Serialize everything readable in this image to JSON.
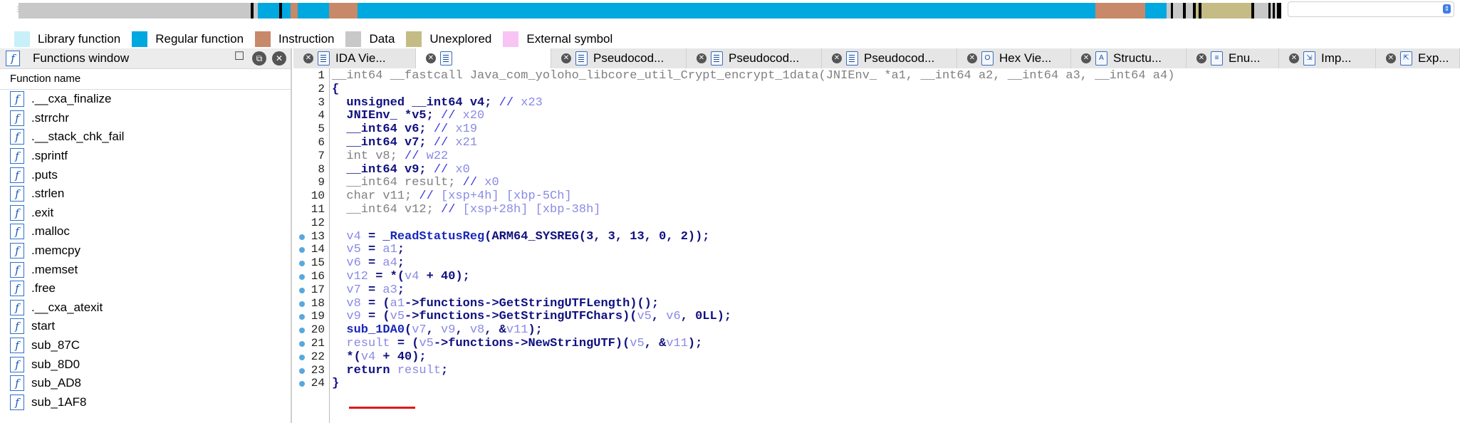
{
  "legend": [
    {
      "label": "Library function",
      "color": "#c8f0f8"
    },
    {
      "label": "Regular function",
      "color": "#00a8e0"
    },
    {
      "label": "Instruction",
      "color": "#c8886a"
    },
    {
      "label": "Data",
      "color": "#c8c8c8"
    },
    {
      "label": "Unexplored",
      "color": "#c4bc84"
    },
    {
      "label": "External symbol",
      "color": "#f8c4f4"
    }
  ],
  "functions_window": {
    "title": "Functions window",
    "column_header": "Function name",
    "items": [
      ".__cxa_finalize",
      ".strrchr",
      ".__stack_chk_fail",
      ".sprintf",
      ".puts",
      ".strlen",
      ".exit",
      ".malloc",
      ".memcpy",
      ".memset",
      ".free",
      ".__cxa_atexit",
      "start",
      "sub_87C",
      "sub_8D0",
      "sub_AD8",
      "sub_1AF8"
    ]
  },
  "tabs": [
    {
      "label": "IDA Vie...",
      "icon": "ida-view-icon"
    },
    {
      "label": "",
      "icon": "pseudocode-icon",
      "active": true
    },
    {
      "label": "Pseudocod...",
      "icon": "pseudocode-icon"
    },
    {
      "label": "Pseudocod...",
      "icon": "pseudocode-icon"
    },
    {
      "label": "Pseudocod...",
      "icon": "pseudocode-icon"
    },
    {
      "label": "Hex Vie...",
      "icon": "hex-view-icon"
    },
    {
      "label": "Structu...",
      "icon": "structures-icon"
    },
    {
      "label": "Enu...",
      "icon": "enums-icon"
    },
    {
      "label": "Imp...",
      "icon": "imports-icon"
    },
    {
      "label": "Exp...",
      "icon": "exports-icon"
    }
  ],
  "code": {
    "lines": [
      {
        "n": "1",
        "bp": false,
        "parts": [
          [
            "gray",
            "__int64 __fastcall Java_com_yoloho_libcore_util_Crypt_encrypt_1data(JNIEnv_ *a1, __int64 a2, __int64 a3, __int64 a4)"
          ]
        ]
      },
      {
        "n": "2",
        "bp": false,
        "parts": [
          [
            "navy",
            "{"
          ]
        ]
      },
      {
        "n": "3",
        "bp": false,
        "parts": [
          [
            "navy",
            "  unsigned __int64 v4; "
          ],
          [
            "cmt",
            "// "
          ],
          [
            "lb",
            "x23"
          ]
        ]
      },
      {
        "n": "4",
        "bp": false,
        "parts": [
          [
            "navy",
            "  JNIEnv_ *v5; "
          ],
          [
            "cmt",
            "// "
          ],
          [
            "lb",
            "x20"
          ]
        ]
      },
      {
        "n": "5",
        "bp": false,
        "parts": [
          [
            "navy",
            "  __int64 v6; "
          ],
          [
            "cmt",
            "// "
          ],
          [
            "lb",
            "x19"
          ]
        ]
      },
      {
        "n": "6",
        "bp": false,
        "parts": [
          [
            "navy",
            "  __int64 v7; "
          ],
          [
            "cmt",
            "// "
          ],
          [
            "lb",
            "x21"
          ]
        ]
      },
      {
        "n": "7",
        "bp": false,
        "parts": [
          [
            "gray",
            "  int v8; "
          ],
          [
            "cmt",
            "// "
          ],
          [
            "lb",
            "w22"
          ]
        ]
      },
      {
        "n": "8",
        "bp": false,
        "parts": [
          [
            "navy",
            "  __int64 v9; "
          ],
          [
            "cmt",
            "// "
          ],
          [
            "lb",
            "x0"
          ]
        ]
      },
      {
        "n": "9",
        "bp": false,
        "parts": [
          [
            "gray",
            "  __int64 result; "
          ],
          [
            "cmt",
            "// "
          ],
          [
            "lb",
            "x0"
          ]
        ]
      },
      {
        "n": "10",
        "bp": false,
        "parts": [
          [
            "gray",
            "  char v11; "
          ],
          [
            "cmt",
            "// "
          ],
          [
            "lb",
            "[xsp+4h] [xbp-5Ch]"
          ]
        ]
      },
      {
        "n": "11",
        "bp": false,
        "parts": [
          [
            "gray",
            "  __int64 v12; "
          ],
          [
            "cmt",
            "// "
          ],
          [
            "lb",
            "[xsp+28h] [xbp-38h]"
          ]
        ]
      },
      {
        "n": "12",
        "bp": false,
        "parts": [
          [
            "gray",
            ""
          ]
        ]
      },
      {
        "n": "13",
        "bp": true,
        "parts": [
          [
            "lb",
            "  v4"
          ],
          [
            "navy",
            " = "
          ],
          [
            "fn",
            "_ReadStatusReg"
          ],
          [
            "navy",
            "(ARM64_SYSREG(3, 3, 13, 0, 2));"
          ]
        ]
      },
      {
        "n": "14",
        "bp": true,
        "parts": [
          [
            "lb",
            "  v5"
          ],
          [
            "navy",
            " = "
          ],
          [
            "lb",
            "a1"
          ],
          [
            "navy",
            ";"
          ]
        ]
      },
      {
        "n": "15",
        "bp": true,
        "parts": [
          [
            "lb",
            "  v6"
          ],
          [
            "navy",
            " = "
          ],
          [
            "lb",
            "a4"
          ],
          [
            "navy",
            ";"
          ]
        ]
      },
      {
        "n": "16",
        "bp": true,
        "parts": [
          [
            "lb",
            "  v12"
          ],
          [
            "navy",
            " = *("
          ],
          [
            "lb",
            "v4"
          ],
          [
            "navy",
            " + 40);"
          ]
        ]
      },
      {
        "n": "17",
        "bp": true,
        "parts": [
          [
            "lb",
            "  v7"
          ],
          [
            "navy",
            " = "
          ],
          [
            "lb",
            "a3"
          ],
          [
            "navy",
            ";"
          ]
        ]
      },
      {
        "n": "18",
        "bp": true,
        "parts": [
          [
            "lb",
            "  v8"
          ],
          [
            "navy",
            " = ("
          ],
          [
            "lb",
            "a1"
          ],
          [
            "navy",
            "->functions->GetStringUTFLength)();"
          ]
        ]
      },
      {
        "n": "19",
        "bp": true,
        "parts": [
          [
            "lb",
            "  v9"
          ],
          [
            "navy",
            " = ("
          ],
          [
            "lb",
            "v5"
          ],
          [
            "navy",
            "->functions->GetStringUTFChars)("
          ],
          [
            "lb",
            "v5"
          ],
          [
            "navy",
            ", "
          ],
          [
            "lb",
            "v6"
          ],
          [
            "navy",
            ", 0LL);"
          ]
        ]
      },
      {
        "n": "20",
        "bp": true,
        "parts": [
          [
            "fn",
            "  sub_1DA0"
          ],
          [
            "navy",
            "("
          ],
          [
            "lb",
            "v7"
          ],
          [
            "navy",
            ", "
          ],
          [
            "lb",
            "v9"
          ],
          [
            "navy",
            ", "
          ],
          [
            "lb",
            "v8"
          ],
          [
            "navy",
            ", &"
          ],
          [
            "lb",
            "v11"
          ],
          [
            "navy",
            ");"
          ]
        ]
      },
      {
        "n": "21",
        "bp": true,
        "parts": [
          [
            "lb",
            "  result"
          ],
          [
            "navy",
            " = ("
          ],
          [
            "lb",
            "v5"
          ],
          [
            "navy",
            "->functions->NewStringUTF)("
          ],
          [
            "lb",
            "v5"
          ],
          [
            "navy",
            ", &"
          ],
          [
            "lb",
            "v11"
          ],
          [
            "navy",
            ");"
          ]
        ]
      },
      {
        "n": "22",
        "bp": true,
        "parts": [
          [
            "navy",
            "  *("
          ],
          [
            "lb",
            "v4"
          ],
          [
            "navy",
            " + 40);"
          ]
        ]
      },
      {
        "n": "23",
        "bp": true,
        "parts": [
          [
            "navy",
            "  return "
          ],
          [
            "lb",
            "result"
          ],
          [
            "navy",
            ";"
          ]
        ]
      },
      {
        "n": "24",
        "bp": true,
        "parts": [
          [
            "navy",
            "}"
          ]
        ]
      }
    ]
  }
}
